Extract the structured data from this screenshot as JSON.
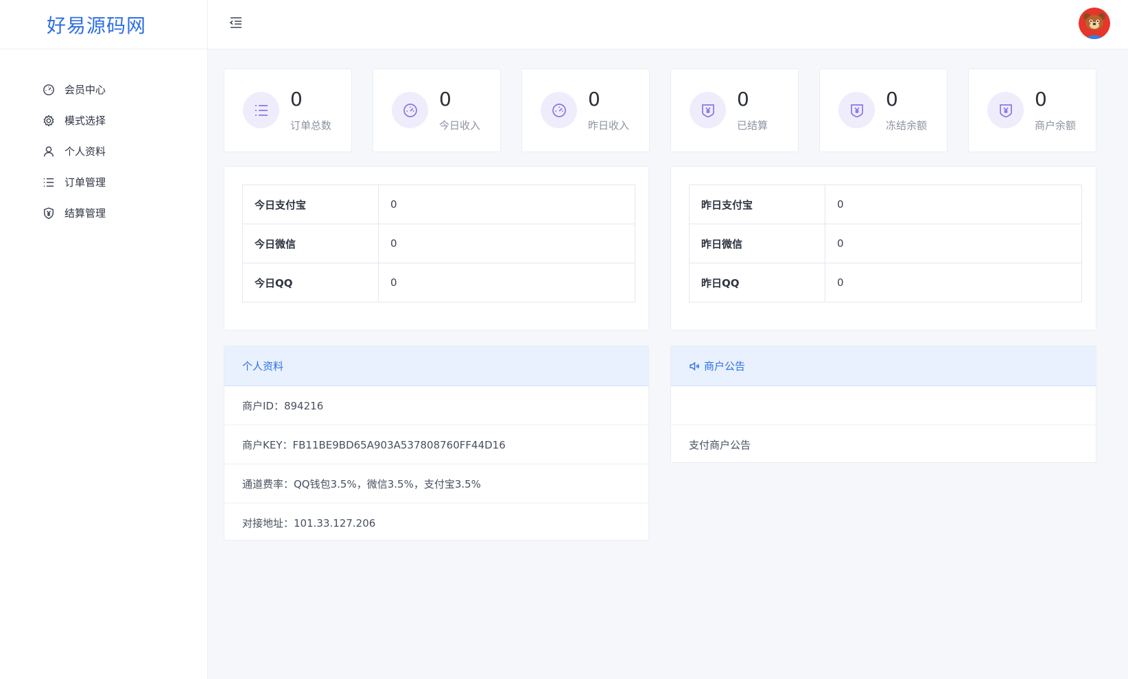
{
  "brand": {
    "logo_text": "好易源码网"
  },
  "sidebar": {
    "items": [
      {
        "label": "会员中心",
        "icon": "dashboard-icon"
      },
      {
        "label": "模式选择",
        "icon": "gear-icon"
      },
      {
        "label": "个人资料",
        "icon": "user-icon"
      },
      {
        "label": "订单管理",
        "icon": "list-icon"
      },
      {
        "label": "结算管理",
        "icon": "shield-yen-icon"
      }
    ]
  },
  "stats": [
    {
      "value": "0",
      "label": "订单总数",
      "icon": "list-icon"
    },
    {
      "value": "0",
      "label": "今日收入",
      "icon": "gauge-icon"
    },
    {
      "value": "0",
      "label": "昨日收入",
      "icon": "gauge-icon"
    },
    {
      "value": "0",
      "label": "已结算",
      "icon": "shield-yen-icon"
    },
    {
      "value": "0",
      "label": "冻结余额",
      "icon": "shield-yen-icon"
    },
    {
      "value": "0",
      "label": "商户余额",
      "icon": "shield-yen-icon"
    }
  ],
  "today_table": [
    {
      "key": "今日支付宝",
      "value": "0"
    },
    {
      "key": "今日微信",
      "value": "0"
    },
    {
      "key": "今日QQ",
      "value": "0"
    }
  ],
  "yesterday_table": [
    {
      "key": "昨日支付宝",
      "value": "0"
    },
    {
      "key": "昨日微信",
      "value": "0"
    },
    {
      "key": "昨日QQ",
      "value": "0"
    }
  ],
  "profile": {
    "title": "个人资料",
    "rows": [
      "商户ID：894216",
      "商户KEY：FB11BE9BD65A903A537808760FF44D16",
      "通道费率：QQ钱包3.5%，微信3.5%，支付宝3.5%",
      "对接地址：101.33.127.206"
    ]
  },
  "notice": {
    "title": "商户公告",
    "rows": [
      "",
      "支付商户公告"
    ]
  },
  "colors": {
    "accent": "#2f6fe4",
    "icon_purple": "#8b74e6",
    "icon_bg": "#efedfc",
    "head_bg": "#e8f1fd"
  }
}
